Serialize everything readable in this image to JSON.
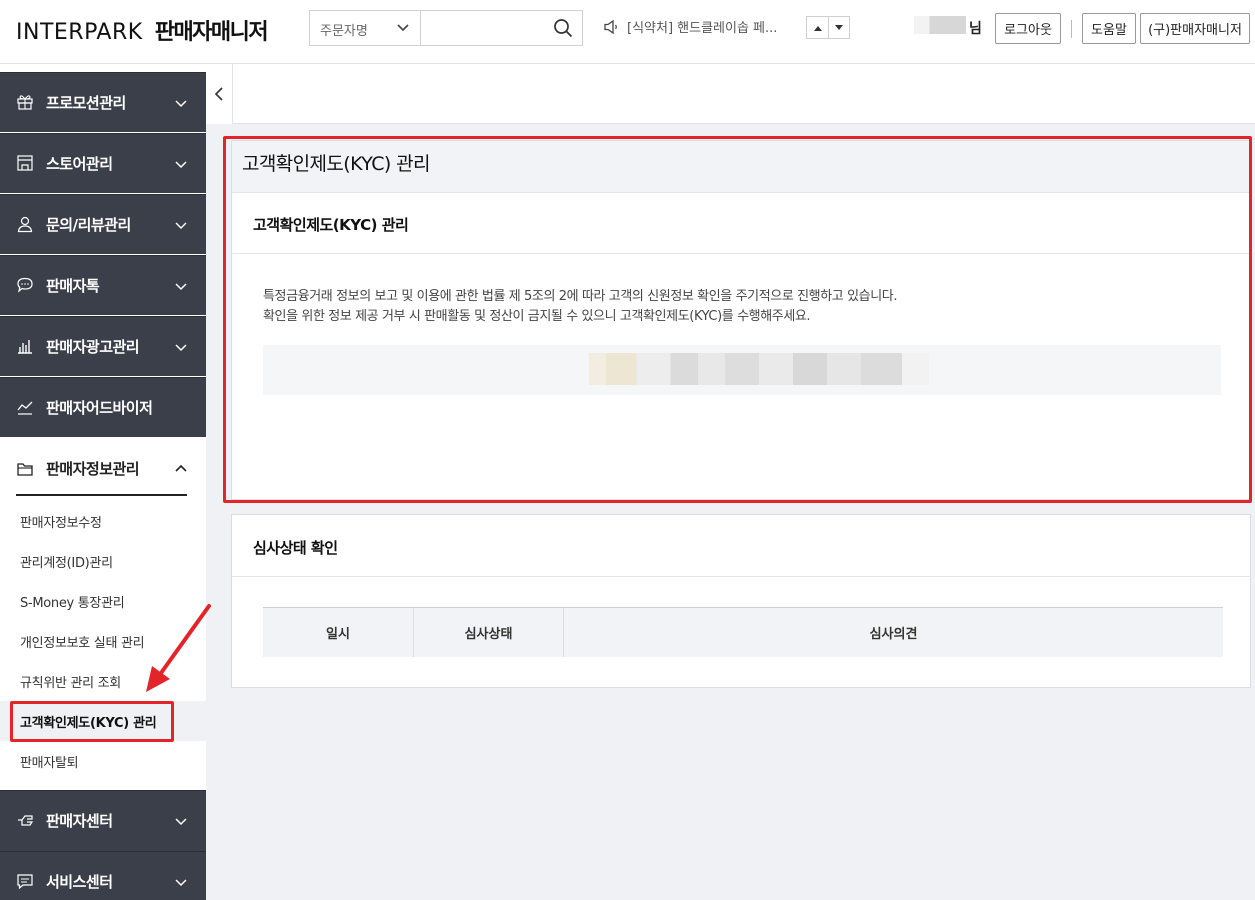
{
  "header": {
    "brand": "INTERPARK",
    "app_title": "판매자매니저",
    "search": {
      "selected_option": "주문자명",
      "value": ""
    },
    "notice_text": "[식약처] 핸드클레이솝 페...",
    "user_suffix": "님",
    "logout_label": "로그아웃",
    "help_label": "도움말",
    "old_manager_label": "(구)판매자매니저"
  },
  "sidebar": {
    "menus": [
      {
        "label": "프로모션관리",
        "icon": "gift-icon"
      },
      {
        "label": "스토어관리",
        "icon": "store-icon"
      },
      {
        "label": "문의/리뷰관리",
        "icon": "person-icon"
      },
      {
        "label": "판매자톡",
        "icon": "chat-icon"
      },
      {
        "label": "판매자광고관리",
        "icon": "bar-chart-icon"
      },
      {
        "label": "판매자어드바이저",
        "icon": "trend-icon"
      }
    ],
    "open_menu": {
      "label": "판매자정보관리",
      "icon": "folder-icon"
    },
    "submenu": [
      "판매자정보수정",
      "관리계정(ID)관리",
      "S-Money 통장관리",
      "개인정보보호 실태 관리",
      "규칙위반 관리 조회",
      "고객확인제도(KYC) 관리",
      "판매자탈퇴"
    ],
    "bottom_menus": [
      {
        "label": "판매자센터",
        "icon": "hand-icon"
      },
      {
        "label": "서비스센터",
        "icon": "message-icon"
      }
    ]
  },
  "kyc": {
    "page_title": "고객확인제도(KYC) 관리",
    "section_title": "고객확인제도(KYC) 관리",
    "desc_line1": "특정금융거래 정보의 보고 및 이용에 관한 법률 제 5조의 2에 따라 고객의 신원정보 확인을 주기적으로 진행하고 있습니다.",
    "desc_line2": "확인을 위한 정보 제공 거부 시 판매활동 및 정산이 금지될 수 있으니 고객확인제도(KYC)를 수행해주세요."
  },
  "review": {
    "title": "심사상태 확인",
    "columns": [
      "일시",
      "심사상태",
      "심사의견"
    ]
  },
  "colors": {
    "sidebar_dark": "#3b3f4a",
    "annotation_red": "#e3252a",
    "page_bg": "#f0f1f4"
  }
}
